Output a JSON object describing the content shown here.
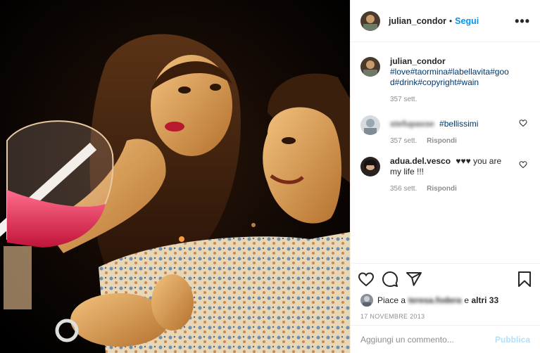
{
  "post": {
    "image_alt": "photo",
    "author": {
      "username": "julian_condor",
      "follow_separator": "•",
      "follow_label": "Segui",
      "more_label": "•••"
    },
    "caption": {
      "username": "julian_condor",
      "hashtags": "#love#taormina#labellavita#good#drink#copyright#wain",
      "time": "357 sett."
    },
    "comments": [
      {
        "username": "stefupasse",
        "text": "#bellissimi",
        "time": "357 sett.",
        "reply_label": "Rispondi"
      },
      {
        "username": "adua.del.vesco",
        "text": "♥♥♥ you are my life !!!",
        "time": "356 sett.",
        "reply_label": "Rispondi"
      }
    ],
    "likes": {
      "prefix": "Piace a",
      "liker": "teresa.fodera",
      "middle": "e",
      "others": "altri 33"
    },
    "date": "17 NOVEMBRE 2013",
    "comment_box": {
      "placeholder": "Aggiungi un commento...",
      "publish_label": "Pubblica"
    }
  },
  "icons": {
    "like": "heart-icon",
    "comment": "comment-bubble-icon",
    "share": "paper-plane-icon",
    "save": "bookmark-icon",
    "more": "ellipsis-icon"
  },
  "colors": {
    "link_blue": "#0095f6",
    "hashtag": "#00376b",
    "muted": "#8e8e8e",
    "publish_disabled": "#b2dffc"
  }
}
